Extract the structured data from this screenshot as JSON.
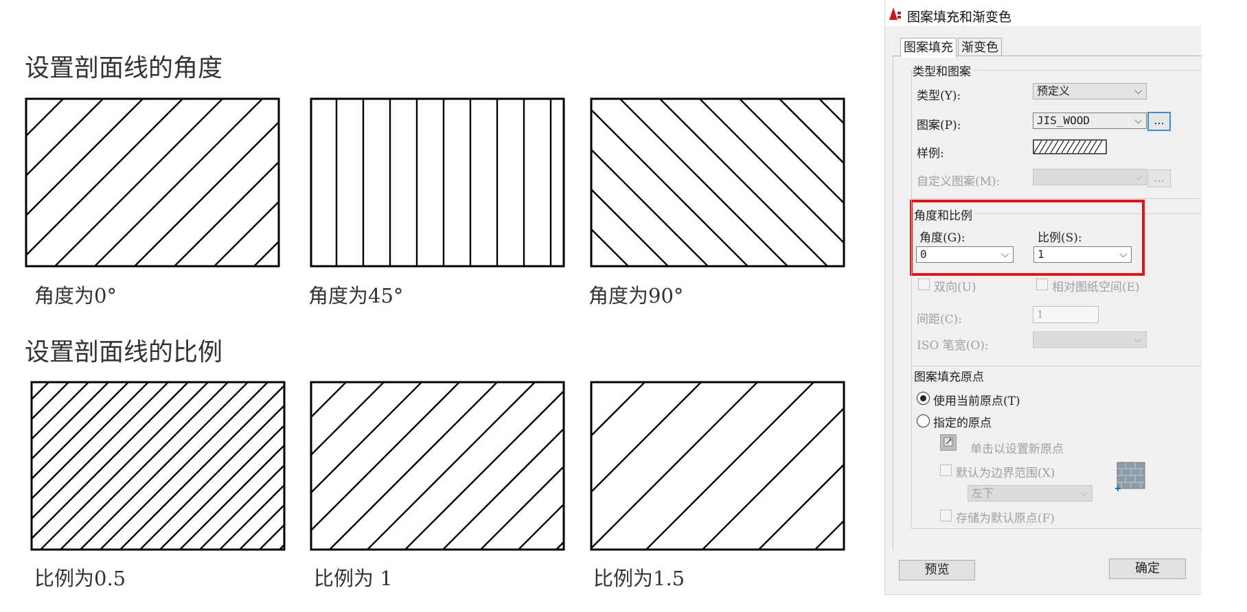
{
  "angle_section": {
    "title": "设置剖面线的角度",
    "captions": [
      "角度为0°",
      "角度为45°",
      "角度为90°"
    ]
  },
  "scale_section": {
    "title": "设置剖面线的比例",
    "captions": [
      "比例为0.5",
      "比例为 1",
      "比例为1.5"
    ]
  },
  "dialog": {
    "title": "图案填充和渐变色",
    "tabs": [
      "图案填充",
      "渐变色"
    ],
    "type_and_pattern": {
      "group_label": "类型和图案",
      "type_label": "类型(Y):",
      "type_value": "预定义",
      "pattern_label": "图案(P):",
      "pattern_value": "JIS_WOOD",
      "pattern_browse": "...",
      "sample_label": "样例:",
      "custom_label": "自定义图案(M):",
      "custom_browse": "..."
    },
    "angle_and_scale": {
      "group_label": "角度和比例",
      "angle_label": "角度(G):",
      "angle_value": "0",
      "scale_label": "比例(S):",
      "scale_value": "1",
      "double_label": "双向(U)",
      "relative_label": "相对图纸空间(E)",
      "spacing_label": "间距(C):",
      "spacing_value": "1",
      "iso_label": "ISO 笔宽(O):"
    },
    "origin": {
      "group_label": "图案填充原点",
      "use_current": "使用当前原点(T)",
      "specified": "指定的原点",
      "click_set": "单击以设置新原点",
      "default_extents": "默认为边界范围(X)",
      "extents_value": "左下",
      "store_default": "存储为默认原点(F)"
    },
    "buttons": {
      "preview": "预览",
      "ok": "确定"
    },
    "colors": {
      "highlight": "#e0151b",
      "focus": "#3c8bd9"
    }
  }
}
